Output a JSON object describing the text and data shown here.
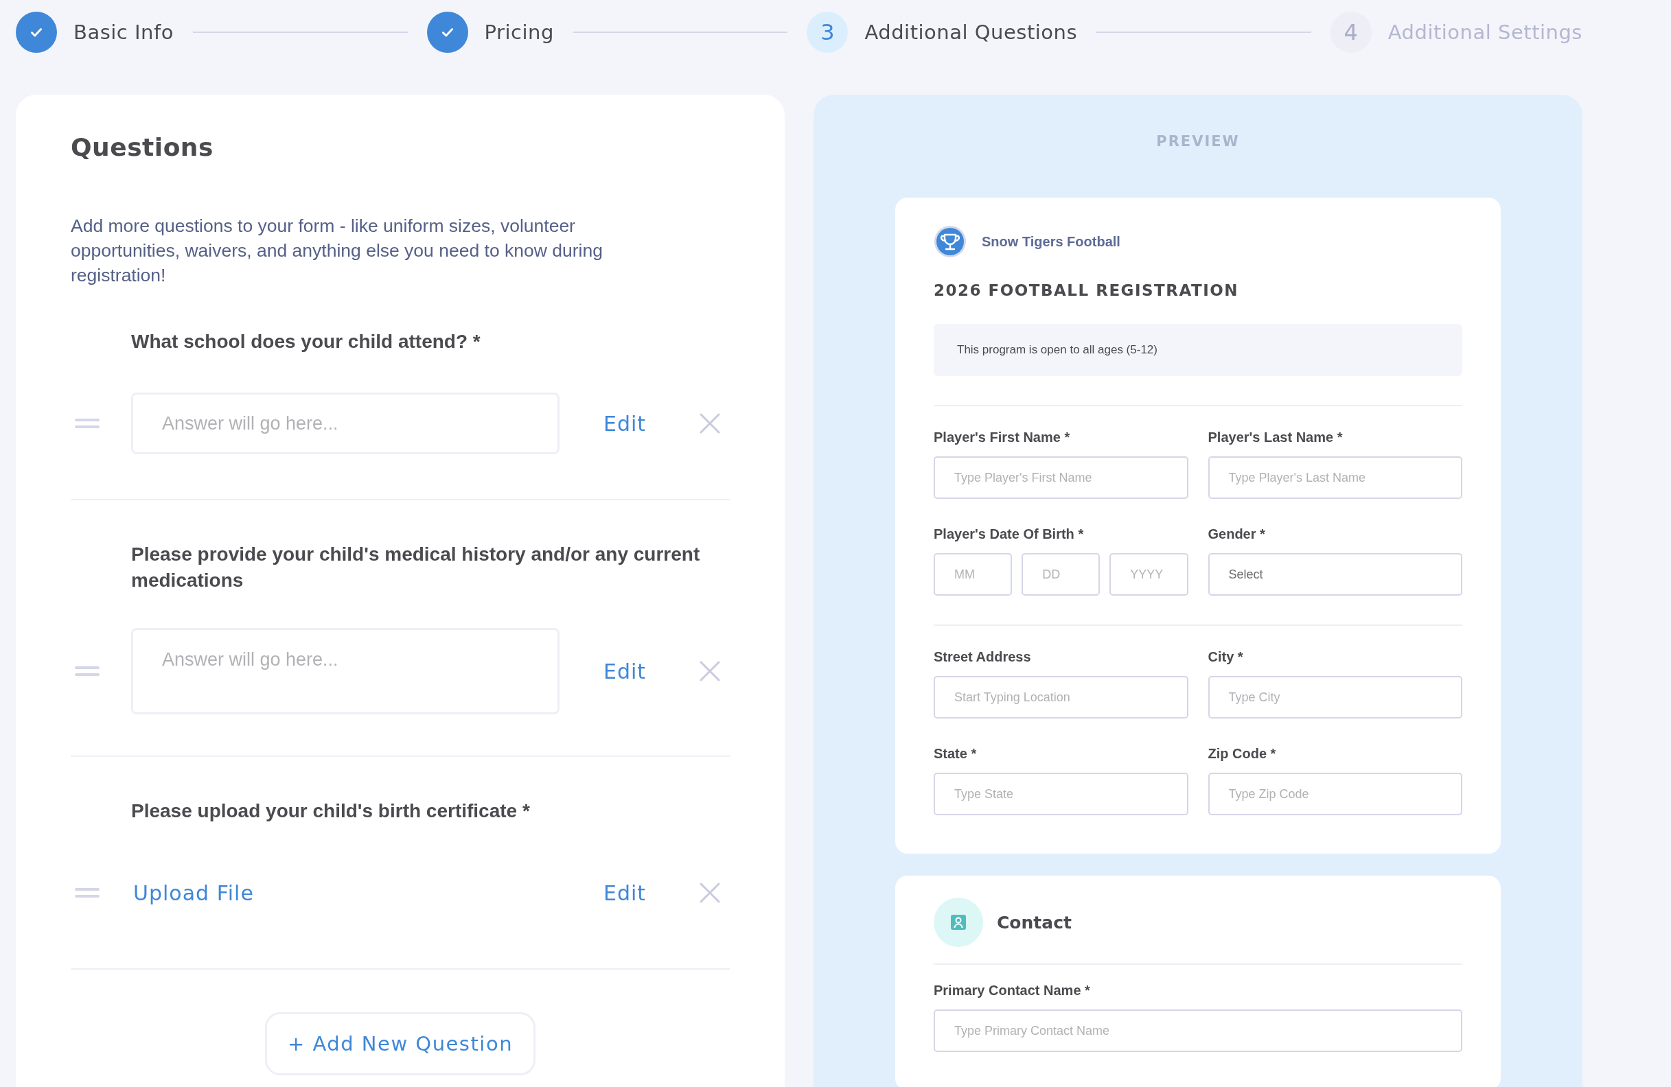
{
  "steps": [
    {
      "label": "Basic Info",
      "completed": true,
      "selected": false
    },
    {
      "label": "Pricing",
      "completed": true,
      "selected": false
    },
    {
      "number": "3",
      "label": "Additional Questions",
      "completed": false,
      "selected": true
    },
    {
      "number": "4",
      "label": "Additional Settings",
      "completed": false,
      "selected": false
    }
  ],
  "questions_panel": {
    "title": "Questions",
    "description": "Add more questions to your form - like uniform sizes, volunteer opportunities, waivers, and anything else you need to know during registration!",
    "questions": [
      {
        "label": "What school does your child attend? *",
        "kind": "text",
        "placeholder": "Answer will go here...",
        "edit": "Edit"
      },
      {
        "label": "Please provide your child's medical history and/or any current medications",
        "kind": "textarea",
        "placeholder": "Answer will go here...",
        "edit": "Edit"
      },
      {
        "label": "Please upload your child's birth certificate  *",
        "kind": "upload",
        "upload": "Upload File",
        "edit": "Edit"
      }
    ],
    "add_button": "+ Add New Question"
  },
  "preview": {
    "heading": "PREVIEW",
    "org_name": "Snow Tigers Football",
    "form_title": "2026 FOOTBALL REGISTRATION",
    "notice": "This program is open to all ages (5-12)",
    "groups": [
      [
        [
          {
            "label": "Player's First Name *",
            "kind": "text",
            "placeholder": "Type Player's First Name"
          },
          {
            "label": "Player's Last Name *",
            "kind": "text",
            "placeholder": "Type Player's Last Name"
          }
        ],
        [
          {
            "label": "Player's Date Of Birth *",
            "kind": "date",
            "parts": [
              "MM",
              "DD",
              "YYYY"
            ]
          },
          {
            "label": "Gender *",
            "kind": "select",
            "placeholder": "Select"
          }
        ]
      ],
      [
        [
          {
            "label": "Street Address",
            "kind": "text",
            "placeholder": "Start Typing Location"
          },
          {
            "label": "City *",
            "kind": "text",
            "placeholder": "Type City"
          }
        ],
        [
          {
            "label": "State *",
            "kind": "text",
            "placeholder": "Type State"
          },
          {
            "label": "Zip Code *",
            "kind": "text",
            "placeholder": "Type Zip Code"
          }
        ]
      ]
    ],
    "contact": {
      "title": "Contact",
      "fields": [
        {
          "label": "Primary Contact Name *",
          "kind": "text",
          "placeholder": "Type Primary Contact Name"
        }
      ]
    }
  }
}
